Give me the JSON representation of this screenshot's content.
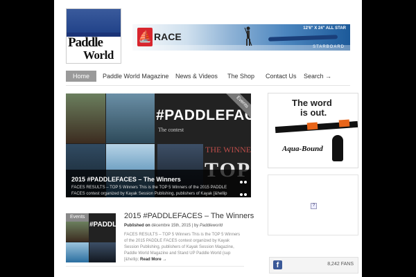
{
  "site": {
    "logo_line1": "Paddle",
    "logo_line2": "World"
  },
  "banner": {
    "race_label": "RACE",
    "board_size": "12'6\" X 24\" ALL STAR",
    "brand": "STARBOARD"
  },
  "nav": {
    "items": [
      "Home",
      "Paddle World Magazine",
      "News & Videos",
      "The Shop",
      "Contact Us",
      "Search →"
    ]
  },
  "slider": {
    "corner_tag": "Events",
    "headline": "#PADDLEFACES",
    "subheadline": "The contest",
    "winners_text": "THE WINNER",
    "top_text": "TOP",
    "caption_title": "2015 #PADDLEFACES – The Winners",
    "caption_text": "FACES RESULTS – TOP 5 Winners This is the TOP 5 Winners of the 2015 PADDLE FACES contest organized by Kayak Session Publishing, publishers of Kayak [&hellip"
  },
  "ads": {
    "aqua_tagline_1": "The word",
    "aqua_tagline_2": "is out.",
    "aqua_brand": "Aqua-Bound"
  },
  "facebook": {
    "count": "8,242",
    "label": "FANS"
  },
  "post": {
    "category": "Events",
    "thumb_title": "#PADDL",
    "title": "2015 #PADDLEFACES – The Winners",
    "meta_prefix": "Published on",
    "date": "décembre 15th, 2015",
    "author_prefix": "by",
    "author": "Paddleworld",
    "excerpt": "FACES RESULTS – TOP 5 Winners This is the TOP 5 Winners of the 2015 PADDLE FACES contest organized by Kayak Session Publishing, publishers of Kayak Session Magazine, Paddle World Magazine and Stand UP Paddle World (sup [&hellip;",
    "read_more": "Read More →"
  },
  "colors": {
    "page_bg": "#000000",
    "content_bg": "#ffffff",
    "nav_active": "#9a9a9a",
    "facebook": "#3b5998",
    "accent_orange": "#e8651a"
  }
}
